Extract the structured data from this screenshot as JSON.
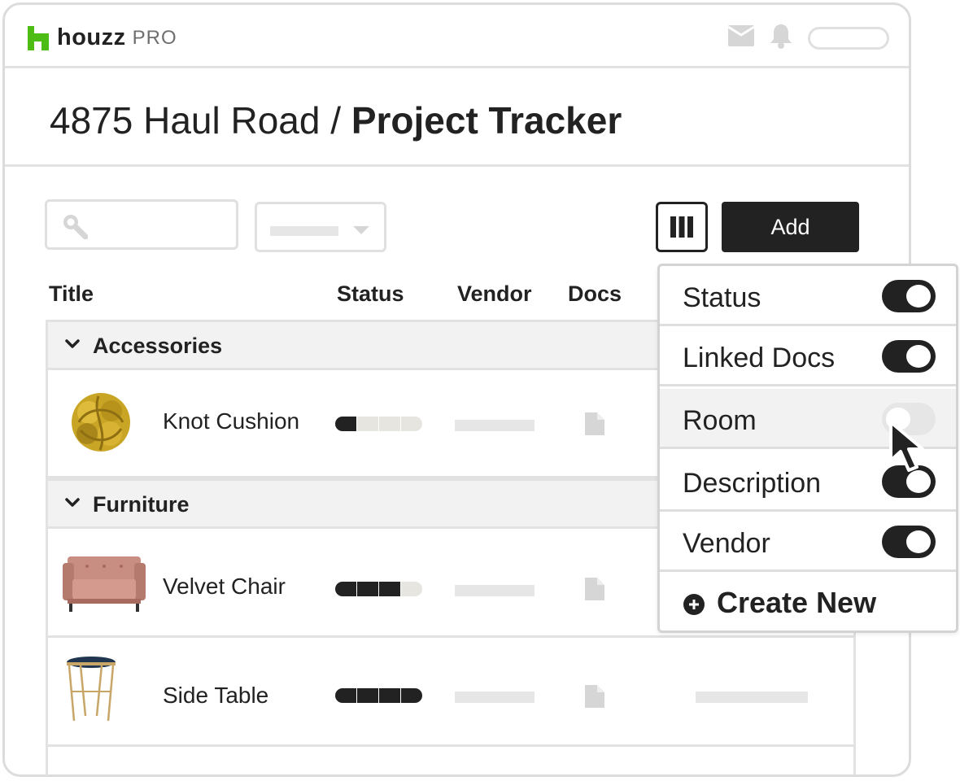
{
  "app": {
    "brand": "houzz",
    "brand_suffix": "PRO",
    "brand_color": "#4dbc15"
  },
  "page": {
    "title_prefix": "4875 Haul Road / ",
    "title_main": "Project Tracker"
  },
  "toolbar": {
    "add_label": "Add",
    "search_icon": "search-icon",
    "columns_icon": "columns-icon"
  },
  "table": {
    "headers": [
      "Title",
      "Status",
      "Vendor",
      "Docs"
    ],
    "groups": [
      {
        "name": "Accessories",
        "items": [
          {
            "name": "Knot Cushion",
            "status_filled": 1,
            "status_total": 4,
            "thumb": "knot-cushion-thumbnail"
          }
        ]
      },
      {
        "name": "Furniture",
        "items": [
          {
            "name": "Velvet Chair",
            "status_filled": 3,
            "status_total": 4,
            "thumb": "velvet-chair-thumbnail"
          },
          {
            "name": "Side Table",
            "status_filled": 4,
            "status_total": 4,
            "thumb": "side-table-thumbnail"
          }
        ]
      }
    ]
  },
  "column_menu": {
    "items": [
      {
        "label": "Status",
        "enabled": true
      },
      {
        "label": "Linked Docs",
        "enabled": true
      },
      {
        "label": "Room",
        "enabled": false,
        "hovered": true
      },
      {
        "label": "Description",
        "enabled": true
      },
      {
        "label": "Vendor",
        "enabled": true
      }
    ],
    "create_label": "Create New"
  }
}
